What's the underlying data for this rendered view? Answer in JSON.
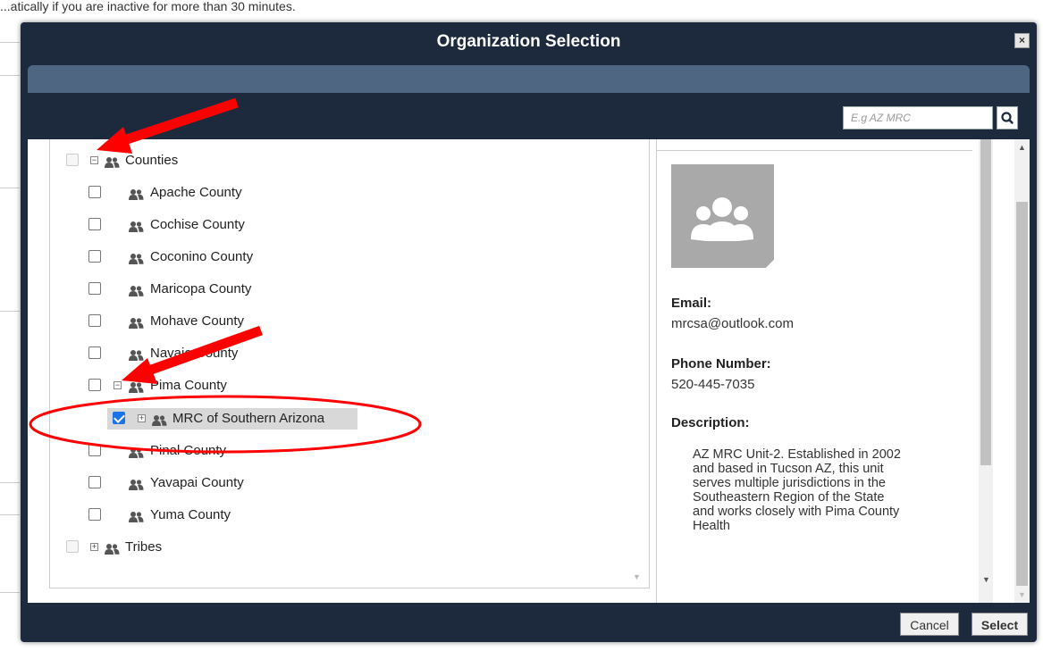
{
  "background": {
    "top_text": "...atically if you are inactive for more than 30 minutes."
  },
  "modal": {
    "title": "Organization Selection",
    "close_label": "×"
  },
  "search": {
    "placeholder": "E.g AZ MRC"
  },
  "tree": [
    {
      "label": "Counties",
      "level": 0,
      "toggle": "minus",
      "checked": false,
      "disabled": true
    },
    {
      "label": "Apache County",
      "level": 1,
      "toggle": "none",
      "checked": false
    },
    {
      "label": "Cochise County",
      "level": 1,
      "toggle": "none",
      "checked": false
    },
    {
      "label": "Coconino County",
      "level": 1,
      "toggle": "none",
      "checked": false
    },
    {
      "label": "Maricopa County",
      "level": 1,
      "toggle": "none",
      "checked": false
    },
    {
      "label": "Mohave County",
      "level": 1,
      "toggle": "none",
      "checked": false
    },
    {
      "label": "Navajo County",
      "level": 1,
      "toggle": "none",
      "checked": false
    },
    {
      "label": "Pima County",
      "level": 1,
      "toggle": "minus",
      "checked": false
    },
    {
      "label": "MRC of Southern Arizona",
      "level": 2,
      "toggle": "plus",
      "checked": true,
      "selected": true
    },
    {
      "label": "Pinal County",
      "level": 1,
      "toggle": "none",
      "checked": false
    },
    {
      "label": "Yavapai County",
      "level": 1,
      "toggle": "none",
      "checked": false
    },
    {
      "label": "Yuma County",
      "level": 1,
      "toggle": "none",
      "checked": false
    },
    {
      "label": "Tribes",
      "level": 0,
      "toggle": "plus",
      "checked": false,
      "disabled": true
    }
  ],
  "detail": {
    "email_label": "Email:",
    "email": "mrcsa@outlook.com",
    "phone_label": "Phone Number:",
    "phone": "520-445-7035",
    "description_label": "Description:",
    "description": "AZ MRC Unit-2. Established in 2002 and based in Tucson AZ, this unit serves multiple jurisdictions in the Southeastern Region of the State and works closely with Pima County Health"
  },
  "footer": {
    "cancel_label": "Cancel",
    "select_label": "Select"
  },
  "colors": {
    "modal_bg": "#1d2a3d",
    "subbar": "#4f6682",
    "annotation_red": "#ff0000",
    "check_blue": "#1a73e8"
  }
}
